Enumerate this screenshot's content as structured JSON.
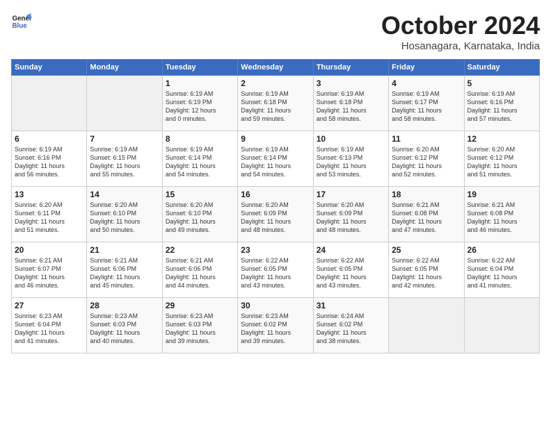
{
  "header": {
    "logo_line1": "General",
    "logo_line2": "Blue",
    "title": "October 2024",
    "subtitle": "Hosanagara, Karnataka, India"
  },
  "weekdays": [
    "Sunday",
    "Monday",
    "Tuesday",
    "Wednesday",
    "Thursday",
    "Friday",
    "Saturday"
  ],
  "weeks": [
    [
      {
        "day": "",
        "info": ""
      },
      {
        "day": "",
        "info": ""
      },
      {
        "day": "1",
        "info": "Sunrise: 6:19 AM\nSunset: 6:19 PM\nDaylight: 12 hours\nand 0 minutes."
      },
      {
        "day": "2",
        "info": "Sunrise: 6:19 AM\nSunset: 6:18 PM\nDaylight: 11 hours\nand 59 minutes."
      },
      {
        "day": "3",
        "info": "Sunrise: 6:19 AM\nSunset: 6:18 PM\nDaylight: 11 hours\nand 58 minutes."
      },
      {
        "day": "4",
        "info": "Sunrise: 6:19 AM\nSunset: 6:17 PM\nDaylight: 11 hours\nand 58 minutes."
      },
      {
        "day": "5",
        "info": "Sunrise: 6:19 AM\nSunset: 6:16 PM\nDaylight: 11 hours\nand 57 minutes."
      }
    ],
    [
      {
        "day": "6",
        "info": "Sunrise: 6:19 AM\nSunset: 6:16 PM\nDaylight: 11 hours\nand 56 minutes."
      },
      {
        "day": "7",
        "info": "Sunrise: 6:19 AM\nSunset: 6:15 PM\nDaylight: 11 hours\nand 55 minutes."
      },
      {
        "day": "8",
        "info": "Sunrise: 6:19 AM\nSunset: 6:14 PM\nDaylight: 11 hours\nand 54 minutes."
      },
      {
        "day": "9",
        "info": "Sunrise: 6:19 AM\nSunset: 6:14 PM\nDaylight: 11 hours\nand 54 minutes."
      },
      {
        "day": "10",
        "info": "Sunrise: 6:19 AM\nSunset: 6:13 PM\nDaylight: 11 hours\nand 53 minutes."
      },
      {
        "day": "11",
        "info": "Sunrise: 6:20 AM\nSunset: 6:12 PM\nDaylight: 11 hours\nand 52 minutes."
      },
      {
        "day": "12",
        "info": "Sunrise: 6:20 AM\nSunset: 6:12 PM\nDaylight: 11 hours\nand 51 minutes."
      }
    ],
    [
      {
        "day": "13",
        "info": "Sunrise: 6:20 AM\nSunset: 6:11 PM\nDaylight: 11 hours\nand 51 minutes."
      },
      {
        "day": "14",
        "info": "Sunrise: 6:20 AM\nSunset: 6:10 PM\nDaylight: 11 hours\nand 50 minutes."
      },
      {
        "day": "15",
        "info": "Sunrise: 6:20 AM\nSunset: 6:10 PM\nDaylight: 11 hours\nand 49 minutes."
      },
      {
        "day": "16",
        "info": "Sunrise: 6:20 AM\nSunset: 6:09 PM\nDaylight: 11 hours\nand 48 minutes."
      },
      {
        "day": "17",
        "info": "Sunrise: 6:20 AM\nSunset: 6:09 PM\nDaylight: 11 hours\nand 48 minutes."
      },
      {
        "day": "18",
        "info": "Sunrise: 6:21 AM\nSunset: 6:08 PM\nDaylight: 11 hours\nand 47 minutes."
      },
      {
        "day": "19",
        "info": "Sunrise: 6:21 AM\nSunset: 6:08 PM\nDaylight: 11 hours\nand 46 minutes."
      }
    ],
    [
      {
        "day": "20",
        "info": "Sunrise: 6:21 AM\nSunset: 6:07 PM\nDaylight: 11 hours\nand 46 minutes."
      },
      {
        "day": "21",
        "info": "Sunrise: 6:21 AM\nSunset: 6:06 PM\nDaylight: 11 hours\nand 45 minutes."
      },
      {
        "day": "22",
        "info": "Sunrise: 6:21 AM\nSunset: 6:06 PM\nDaylight: 11 hours\nand 44 minutes."
      },
      {
        "day": "23",
        "info": "Sunrise: 6:22 AM\nSunset: 6:05 PM\nDaylight: 11 hours\nand 43 minutes."
      },
      {
        "day": "24",
        "info": "Sunrise: 6:22 AM\nSunset: 6:05 PM\nDaylight: 11 hours\nand 43 minutes."
      },
      {
        "day": "25",
        "info": "Sunrise: 6:22 AM\nSunset: 6:05 PM\nDaylight: 11 hours\nand 42 minutes."
      },
      {
        "day": "26",
        "info": "Sunrise: 6:22 AM\nSunset: 6:04 PM\nDaylight: 11 hours\nand 41 minutes."
      }
    ],
    [
      {
        "day": "27",
        "info": "Sunrise: 6:23 AM\nSunset: 6:04 PM\nDaylight: 11 hours\nand 41 minutes."
      },
      {
        "day": "28",
        "info": "Sunrise: 6:23 AM\nSunset: 6:03 PM\nDaylight: 11 hours\nand 40 minutes."
      },
      {
        "day": "29",
        "info": "Sunrise: 6:23 AM\nSunset: 6:03 PM\nDaylight: 11 hours\nand 39 minutes."
      },
      {
        "day": "30",
        "info": "Sunrise: 6:23 AM\nSunset: 6:02 PM\nDaylight: 11 hours\nand 39 minutes."
      },
      {
        "day": "31",
        "info": "Sunrise: 6:24 AM\nSunset: 6:02 PM\nDaylight: 11 hours\nand 38 minutes."
      },
      {
        "day": "",
        "info": ""
      },
      {
        "day": "",
        "info": ""
      }
    ]
  ]
}
